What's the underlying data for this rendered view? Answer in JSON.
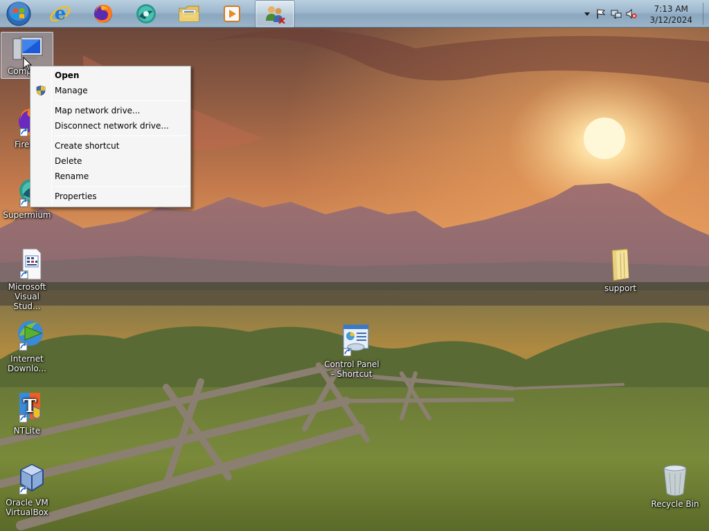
{
  "taskbar": {
    "apps": [
      {
        "name": "start-button"
      },
      {
        "name": "internet-explorer"
      },
      {
        "name": "firefox"
      },
      {
        "name": "supermium"
      },
      {
        "name": "file-explorer"
      },
      {
        "name": "media-player"
      },
      {
        "name": "user-accounts",
        "active": true
      }
    ],
    "clock": {
      "time": "7:13 AM",
      "date": "3/12/2024"
    }
  },
  "desktop": {
    "icons": [
      {
        "label": "Comp",
        "icon": "computer-icon"
      },
      {
        "label": "Firef",
        "icon": "firefox-icon"
      },
      {
        "label": "Supermium",
        "icon": "supermium-icon"
      },
      {
        "label": "Microsoft Visual Stud...",
        "icon": "visual-studio-icon"
      },
      {
        "label": "Internet Downlo...",
        "icon": "idm-icon"
      },
      {
        "label": "NTLite",
        "icon": "ntlite-icon"
      },
      {
        "label": "Oracle VM VirtualBox",
        "icon": "virtualbox-icon"
      },
      {
        "label": "Control Panel - Shortcut",
        "icon": "control-panel-icon"
      },
      {
        "label": "support",
        "icon": "folder-icon"
      },
      {
        "label": "Recycle Bin",
        "icon": "recycle-bin-icon"
      }
    ]
  },
  "context_menu": {
    "items": [
      {
        "label": "Open",
        "bold": true
      },
      {
        "label": "Manage",
        "icon": "shield-icon"
      },
      {
        "label": "Map network drive..."
      },
      {
        "label": "Disconnect network drive..."
      },
      {
        "label": "Create shortcut"
      },
      {
        "label": "Delete"
      },
      {
        "label": "Rename"
      },
      {
        "label": "Properties"
      }
    ]
  },
  "colors": {
    "taskbar": "#9db7cd",
    "menu_bg": "#f5f5f5",
    "sky_top": "#6e4a3e",
    "sun": "#fff6c8"
  }
}
